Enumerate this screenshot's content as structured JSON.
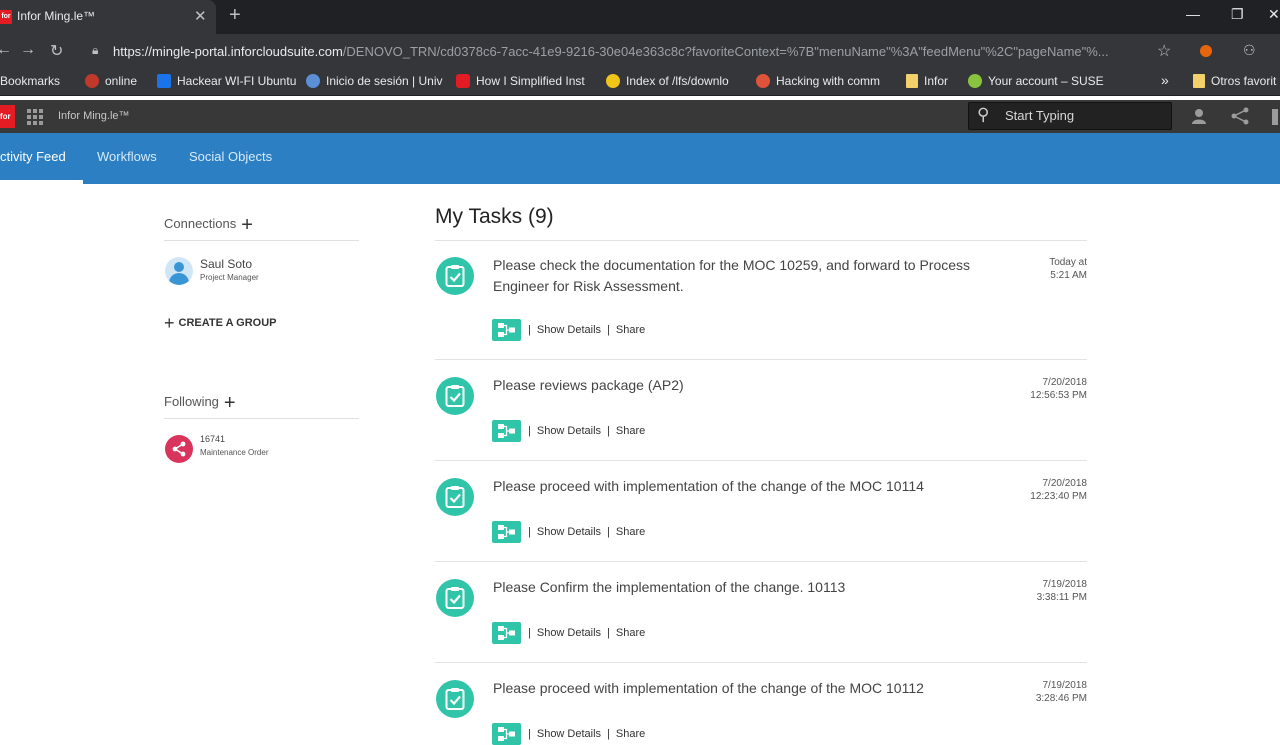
{
  "browser": {
    "tab_title": "Infor Ming.le™",
    "tab_favicon_text": "for",
    "url_host": "https://mingle-portal.inforcloudsuite.com",
    "url_path": "/DENOVO_TRN/cd0378c6-7acc-41e9-9216-30e04e363c8c?favoriteContext=%7B\"menuName\"%3A\"feedMenu\"%2C\"pageName\"%...",
    "bookmarks": [
      {
        "label": "Bookmarks",
        "color": "#e8eaed"
      },
      {
        "label": "online",
        "color": "#c0392b"
      },
      {
        "label": "Hackear WI-FI Ubuntu",
        "color": "#1a73e8"
      },
      {
        "label": "Inicio de sesión | Univ",
        "color": "#5b8fd6"
      },
      {
        "label": "How I Simplified Inst",
        "color": "#e31b23"
      },
      {
        "label": "Index of /lfs/downlo",
        "color": "#f0c419"
      },
      {
        "label": "Hacking with comm",
        "color": "#e0533b"
      },
      {
        "label": "Infor",
        "color": "#f2d16b"
      },
      {
        "label": "Your account – SUSE",
        "color": "#8ac43f"
      },
      {
        "label": "Otros favorit",
        "color": "#f2d16b"
      }
    ]
  },
  "app": {
    "logo_text": "for",
    "name": "Infor Ming.le™",
    "search_placeholder": "Start Typing"
  },
  "nav": {
    "tabs": [
      {
        "label": "ctivity Feed"
      },
      {
        "label": "Workflows"
      },
      {
        "label": "Social Objects"
      }
    ]
  },
  "sidebar": {
    "connections_label": "Connections",
    "person": {
      "name": "Saul Soto",
      "role": "Project Manager"
    },
    "create_group_label": "CREATE A GROUP",
    "following_label": "Following",
    "followed": {
      "id": "16741",
      "type": "Maintenance Order"
    }
  },
  "main": {
    "title": "My Tasks (9)",
    "show_details_label": "Show Details",
    "share_label": "Share",
    "separator": "|",
    "tasks": [
      {
        "text": "Please check the documentation for the MOC 10259, and forward to Process Engineer for Risk Assessment.",
        "date": "Today at\n5:21 AM"
      },
      {
        "text": "Please reviews package (AP2)",
        "date": "7/20/2018\n12:56:53 PM"
      },
      {
        "text": "Please proceed with implementation of the change of the MOC 10114",
        "date": "7/20/2018\n12:23:40 PM"
      },
      {
        "text": "Please Confirm the implementation of the change. 10113",
        "date": "7/19/2018\n3:38:11 PM"
      },
      {
        "text": "Please proceed with implementation of the change of the MOC 10112",
        "date": "7/19/2018\n3:28:46 PM"
      }
    ]
  },
  "colors": {
    "nav_blue": "#2b7fc2",
    "task_teal": "#30c4a9",
    "infor_red": "#e31b23",
    "share_pink": "#d9345b"
  }
}
